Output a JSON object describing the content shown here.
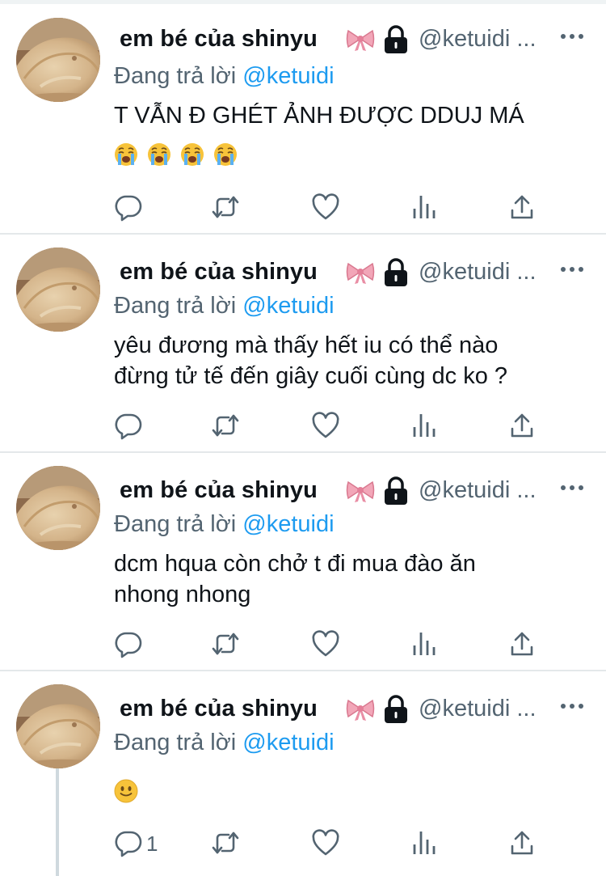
{
  "tweets": [
    {
      "display_name": "em bé của shinyu",
      "handle": "@ketuidi ...",
      "reply_prefix": "Đang trả lời",
      "reply_mention": "@ketuidi",
      "text_lines": [
        "T VẪN Đ GHÉT ẢNH ĐƯỢC DDUJ MÁ"
      ],
      "emojis": [
        "loudly-crying-face",
        "loudly-crying-face",
        "loudly-crying-face",
        "loudly-crying-face"
      ],
      "reply_count": ""
    },
    {
      "display_name": "em bé của shinyu",
      "handle": "@ketuidi ...",
      "reply_prefix": "Đang trả lời",
      "reply_mention": "@ketuidi",
      "text_lines": [
        "yêu đương mà thấy hết iu có thể nào",
        "đừng tử tế đến giây cuối cùng dc ko ?"
      ],
      "emojis": [],
      "reply_count": ""
    },
    {
      "display_name": "em bé của shinyu",
      "handle": "@ketuidi ...",
      "reply_prefix": "Đang trả lời",
      "reply_mention": "@ketuidi",
      "text_lines": [
        "dcm hqua còn chở t đi mua đào ăn",
        "nhong nhong"
      ],
      "emojis": [],
      "reply_count": ""
    },
    {
      "display_name": "em bé của shinyu",
      "handle": "@ketuidi ...",
      "reply_prefix": "Đang trả lời",
      "reply_mention": "@ketuidi",
      "text_lines": [],
      "emojis": [
        "slightly-smiling-face"
      ],
      "reply_count": "1"
    }
  ],
  "icons": {
    "badge_emoji": "ribbon-icon",
    "protected": "lock-icon",
    "more": "more-icon",
    "reply": "reply-icon",
    "retweet": "retweet-icon",
    "like": "like-icon",
    "views": "analytics-icon",
    "share": "share-icon"
  },
  "colors": {
    "link": "#1d9bf0",
    "secondary_text": "#536471",
    "primary_text": "#0f1419",
    "divider": "#e4e8ea"
  }
}
